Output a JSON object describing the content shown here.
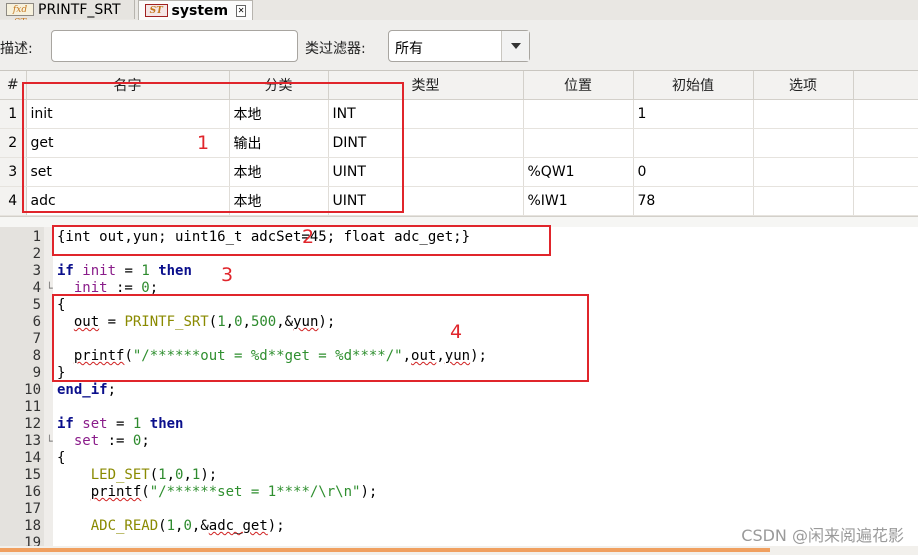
{
  "tabs": [
    {
      "icon_text": "fxd ST",
      "label": "PRINTF_SRT",
      "active": false
    },
    {
      "icon_text": "ST",
      "label": "system",
      "active": true,
      "close": "✕"
    }
  ],
  "filter": {
    "desc_label": "描述:",
    "desc_value": "",
    "class_filter_label": "类过滤器:",
    "class_filter_selected": "所有"
  },
  "table": {
    "headers": [
      "#",
      "名字",
      "分类",
      "类型",
      "位置",
      "初始值",
      "选项"
    ],
    "rows": [
      {
        "num": "1",
        "name": "init",
        "class": "本地",
        "type": "INT",
        "location": "",
        "initial": "1",
        "option": ""
      },
      {
        "num": "2",
        "name": "get",
        "class": "输出",
        "type": "DINT",
        "location": "",
        "initial": "",
        "option": ""
      },
      {
        "num": "3",
        "name": "set",
        "class": "本地",
        "type": "UINT",
        "location": "%QW1",
        "initial": "0",
        "option": ""
      },
      {
        "num": "4",
        "name": "adc",
        "class": "本地",
        "type": "UINT",
        "location": "%IW1",
        "initial": "78",
        "option": ""
      }
    ]
  },
  "code_lines": [
    {
      "no": "1",
      "code": "{int out,yun; uint16_t adcSet=45; float adc_get;}"
    },
    {
      "no": "2",
      "code": ""
    },
    {
      "no": "3",
      "code": "if init = 1 then"
    },
    {
      "no": "4",
      "code": "  init := 0;"
    },
    {
      "no": "5",
      "code": "{"
    },
    {
      "no": "6",
      "code": "  out = PRINTF_SRT(1,0,500,&yun);"
    },
    {
      "no": "7",
      "code": ""
    },
    {
      "no": "8",
      "code": "  printf(\"/******out = %d**get = %d****/\",out,yun);"
    },
    {
      "no": "9",
      "code": "}"
    },
    {
      "no": "10",
      "code": "end_if;"
    },
    {
      "no": "11",
      "code": ""
    },
    {
      "no": "12",
      "code": "if set = 1 then"
    },
    {
      "no": "13",
      "code": "  set := 0;"
    },
    {
      "no": "14",
      "code": "{"
    },
    {
      "no": "15",
      "code": "    LED_SET(1,0,1);"
    },
    {
      "no": "16",
      "code": "    printf(\"/******set = 1****/\\r\\n\");"
    },
    {
      "no": "17",
      "code": ""
    },
    {
      "no": "18",
      "code": "    ADC_READ(1,0,&adc_get);"
    },
    {
      "no": "19",
      "code": ""
    }
  ],
  "annotations": [
    "1",
    "2",
    "3",
    "4"
  ],
  "watermark": "CSDN @闲来阅遍花影",
  "colors": {
    "annotation": "#e0252b",
    "keyword": "#0a0f8c",
    "variable": "#8a1c8a",
    "number": "#2d8a2d",
    "string": "#2f8f2f"
  }
}
